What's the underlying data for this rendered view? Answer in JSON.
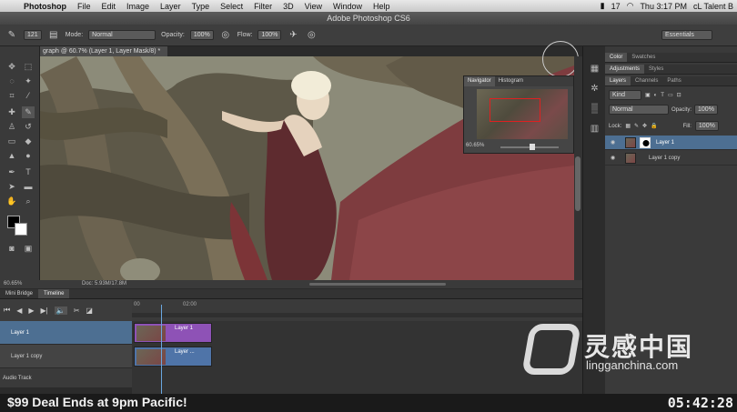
{
  "menubar": {
    "app": "Photoshop",
    "menus": [
      "File",
      "Edit",
      "Image",
      "Layer",
      "Type",
      "Select",
      "Filter",
      "3D",
      "View",
      "Window",
      "Help"
    ],
    "battery": "17",
    "clock": "Thu 3:17 PM",
    "user": "cL Talent B"
  },
  "window": {
    "title": "Adobe Photoshop CS6"
  },
  "options": {
    "brush_size": "121",
    "mode_label": "Mode:",
    "mode_value": "Normal",
    "opacity_label": "Opacity:",
    "opacity_value": "100%",
    "flow_label": "Flow:",
    "flow_value": "100%",
    "workspace": "Essentials"
  },
  "document": {
    "tab": "graph @ 60.7% (Layer 1, Layer Mask/8) *",
    "zoom": "60.65%",
    "info": "Doc: 5.93M/17.8M"
  },
  "navigator": {
    "tabs": [
      "Navigator",
      "Histogram"
    ],
    "zoom": "60.65%"
  },
  "panels": {
    "color_tabs": [
      "Color",
      "Swatches"
    ],
    "adj_tabs": [
      "Adjustments",
      "Styles"
    ],
    "layer_tabs": [
      "Layers",
      "Channels",
      "Paths"
    ],
    "kind_label": "Kind",
    "blend_mode": "Normal",
    "opacity_label": "Opacity:",
    "opacity_value": "100%",
    "lock_label": "Lock:",
    "fill_label": "Fill:",
    "fill_value": "100%",
    "layers": [
      {
        "name": "Layer 1",
        "selected": true
      },
      {
        "name": "Layer 1 copy",
        "selected": false
      }
    ]
  },
  "timeline": {
    "tabs": [
      "Mini Bridge",
      "Timeline"
    ],
    "ruler": [
      "00",
      "02:00"
    ],
    "tracks": [
      "Layer 1",
      "Layer 1 copy",
      "Audio Track"
    ],
    "clips": [
      "Layer 1",
      "Layer ..."
    ]
  },
  "banner": {
    "deal": "$99 Deal Ends at 9pm Pacific!",
    "clock": "05:42:28"
  },
  "watermark": {
    "cn": "灵感中国",
    "url": "lingganchina.com"
  },
  "colors": {
    "accent_blue": "#4d6f92",
    "clip_purple": "#8e52b6",
    "clip_blue": "#4f74a8",
    "navigator_view": "#e02020"
  }
}
